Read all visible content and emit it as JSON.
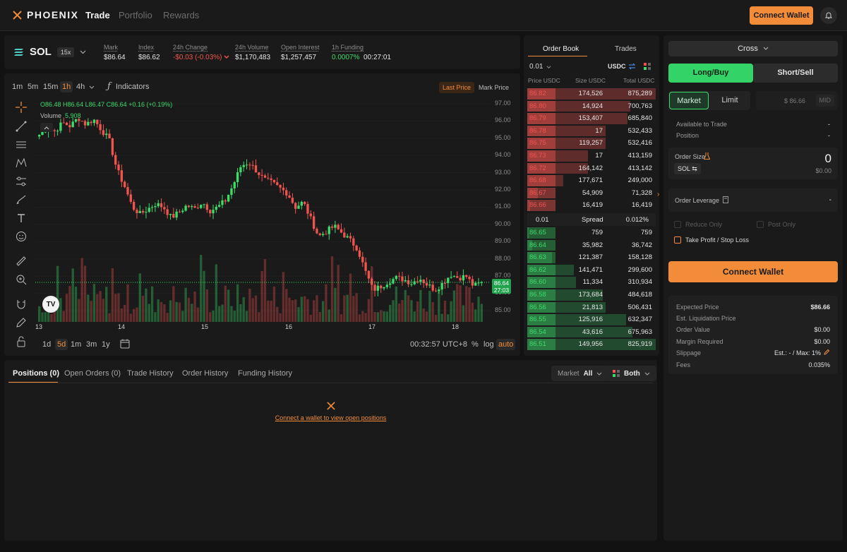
{
  "app": {
    "brand": "PHOENIX",
    "nav": [
      "Trade",
      "Portfolio",
      "Rewards"
    ],
    "connect_wallet": "Connect Wallet"
  },
  "colors": {
    "accent": "#f28c38",
    "up": "#3ddc6a",
    "down": "#f0544f",
    "panel": "#1a1a1a"
  },
  "market": {
    "symbol": "SOL",
    "leverage": "15x",
    "stats": [
      {
        "label": "Mark",
        "value": "$86.64"
      },
      {
        "label": "Index",
        "value": "$86.62"
      },
      {
        "label": "24h Change",
        "value": "-$0.03 (-0.03%)"
      },
      {
        "label": "24h Volume",
        "value": "$1,170,483"
      },
      {
        "label": "Open Interest",
        "value": "$1,257,457"
      },
      {
        "label": "1h Funding",
        "value": "0.0007%",
        "extra": "00:27:01"
      }
    ]
  },
  "chart": {
    "timeframes": [
      "1m",
      "5m",
      "15m",
      "1h",
      "4h"
    ],
    "active_timeframe": "1h",
    "indicators": "Indicators",
    "price_sources": [
      "Last Price",
      "Mark Price"
    ],
    "ohlc": {
      "o": "O86.48",
      "h": "H86.64",
      "l": "L86.47",
      "c": "C86.64",
      "chg": "+0.16 (+0.19%)"
    },
    "volume_label": "Volume",
    "volume_value": "5,908",
    "ranges": [
      "1d",
      "5d",
      "1m",
      "3m",
      "1y"
    ],
    "active_range": "5d",
    "clock": "00:32:57 UTC+8",
    "scale_opts": [
      "%",
      "log",
      "auto"
    ],
    "badge_price": "86.64",
    "badge_time": "27:03"
  },
  "chart_data": {
    "type": "candlestick",
    "ylim": [
      84.5,
      97.5
    ],
    "y_ticks": [
      "97.00",
      "96.00",
      "95.00",
      "94.00",
      "93.00",
      "92.00",
      "91.00",
      "90.00",
      "89.00",
      "88.00",
      "87.00",
      "86.00",
      "85.00"
    ],
    "x_ticks": [
      "13",
      "14",
      "15",
      "16",
      "17",
      "18"
    ],
    "close_path": [
      95.2,
      95.6,
      95.4,
      95.9,
      95.7,
      96.2,
      95.8,
      96.1,
      95.5,
      94.9,
      93.2,
      92.2,
      91.0,
      90.6,
      90.9,
      91.2,
      91.0,
      90.4,
      90.7,
      91.1,
      90.9,
      91.3,
      90.8,
      91.0,
      91.4,
      92.3,
      93.4,
      93.6,
      93.1,
      92.6,
      92.4,
      92.1,
      91.8,
      91.0,
      91.3,
      90.3,
      89.3,
      89.6,
      89.9,
      89.5,
      89.1,
      88.6,
      87.3,
      86.2,
      86.4,
      86.7,
      86.9,
      86.8,
      86.6,
      86.9,
      86.5,
      86.2,
      86.6,
      87.1,
      86.9,
      87.0,
      86.4,
      86.64
    ]
  },
  "orderbook": {
    "tabs": [
      "Order Book",
      "Trades"
    ],
    "tick": "0.01",
    "quote": "USDC",
    "headers": [
      "Price USDC",
      "Size USDC",
      "Total USDC"
    ],
    "asks": [
      [
        "86.82",
        "174,526",
        "875,289"
      ],
      [
        "86.80",
        "14,924",
        "700,763"
      ],
      [
        "86.79",
        "153,407",
        "685,840"
      ],
      [
        "86.78",
        "17",
        "532,433"
      ],
      [
        "86.75",
        "119,257",
        "532,416"
      ],
      [
        "86.73",
        "17",
        "413,159"
      ],
      [
        "86.72",
        "164,142",
        "413,142"
      ],
      [
        "86.68",
        "177,671",
        "249,000"
      ],
      [
        "86.67",
        "54,909",
        "71,328"
      ],
      [
        "86.66",
        "16,419",
        "16,419"
      ]
    ],
    "ask_depth": [
      1.0,
      0.8,
      0.78,
      0.61,
      0.61,
      0.47,
      0.47,
      0.28,
      0.08,
      0.02
    ],
    "spread": {
      "value": "0.01",
      "label": "Spread",
      "pct": "0.012%"
    },
    "bids": [
      [
        "86.65",
        "759",
        "759"
      ],
      [
        "86.64",
        "35,982",
        "36,742"
      ],
      [
        "86.63",
        "121,387",
        "158,128"
      ],
      [
        "86.62",
        "141,471",
        "299,600"
      ],
      [
        "86.60",
        "11,334",
        "310,934"
      ],
      [
        "86.58",
        "173,684",
        "484,618"
      ],
      [
        "86.56",
        "21,813",
        "506,431"
      ],
      [
        "86.55",
        "125,916",
        "632,347"
      ],
      [
        "86.54",
        "43,616",
        "675,963"
      ],
      [
        "86.51",
        "149,956",
        "825,919"
      ]
    ],
    "bid_depth": [
      0.01,
      0.04,
      0.19,
      0.36,
      0.38,
      0.59,
      0.61,
      0.77,
      0.82,
      1.0
    ]
  },
  "order": {
    "margin_mode": "Cross",
    "sides": [
      "Long/Buy",
      "Short/Sell"
    ],
    "types": [
      "Market",
      "Limit"
    ],
    "price_placeholder": "$ 86.66",
    "mid": "MID",
    "available_label": "Available to Trade",
    "available_value": "-",
    "position_label": "Position",
    "position_value": "-",
    "size_label": "Order Size",
    "size_value": "0",
    "size_usd": "$0.00",
    "size_asset": "SOL",
    "leverage_label": "Order Leverage",
    "leverage_value": "-",
    "reduce_only": "Reduce Only",
    "post_only": "Post Only",
    "tpsl": "Take Profit / Stop Loss",
    "connect": "Connect Wallet",
    "summary": [
      {
        "label": "Expected Price",
        "value": "$86.66"
      },
      {
        "label": "Est. Liquidation Price",
        "value": ""
      },
      {
        "label": "Order Value",
        "value": "$0.00"
      },
      {
        "label": "Margin Required",
        "value": "$0.00"
      },
      {
        "label": "Slippage",
        "value": "Est.: - / Max: 1%"
      },
      {
        "label": "Fees",
        "value": "0.035%"
      }
    ]
  },
  "positions": {
    "tabs": [
      "Positions (0)",
      "Open Orders (0)",
      "Trade History",
      "Order History",
      "Funding History"
    ],
    "filter_label": "Market",
    "filter_value": "All",
    "side_filter": "Both",
    "empty_msg": "Connect a wallet to view open positions"
  }
}
